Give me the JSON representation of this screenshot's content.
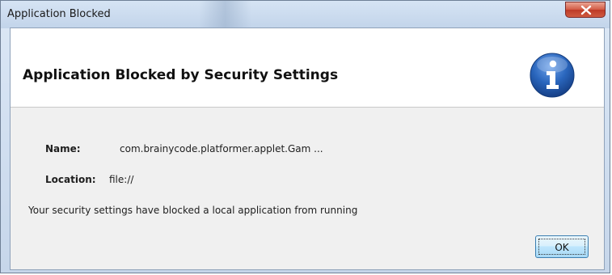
{
  "window": {
    "title": "Application Blocked"
  },
  "banner": {
    "heading": "Application Blocked by Security Settings",
    "icon": "info-icon"
  },
  "details": {
    "name_label": "Name:",
    "name_value": "com.brainycode.platformer.applet.Gam ...",
    "location_label": "Location:",
    "location_value": "file://"
  },
  "message": "Your security settings have blocked a local application from running",
  "buttons": {
    "ok_label": "OK",
    "close_icon": "close-icon"
  },
  "colors": {
    "close_button": "#c8452f",
    "info_icon": "#1f5fb0",
    "focus_button": "#bee6fd"
  }
}
